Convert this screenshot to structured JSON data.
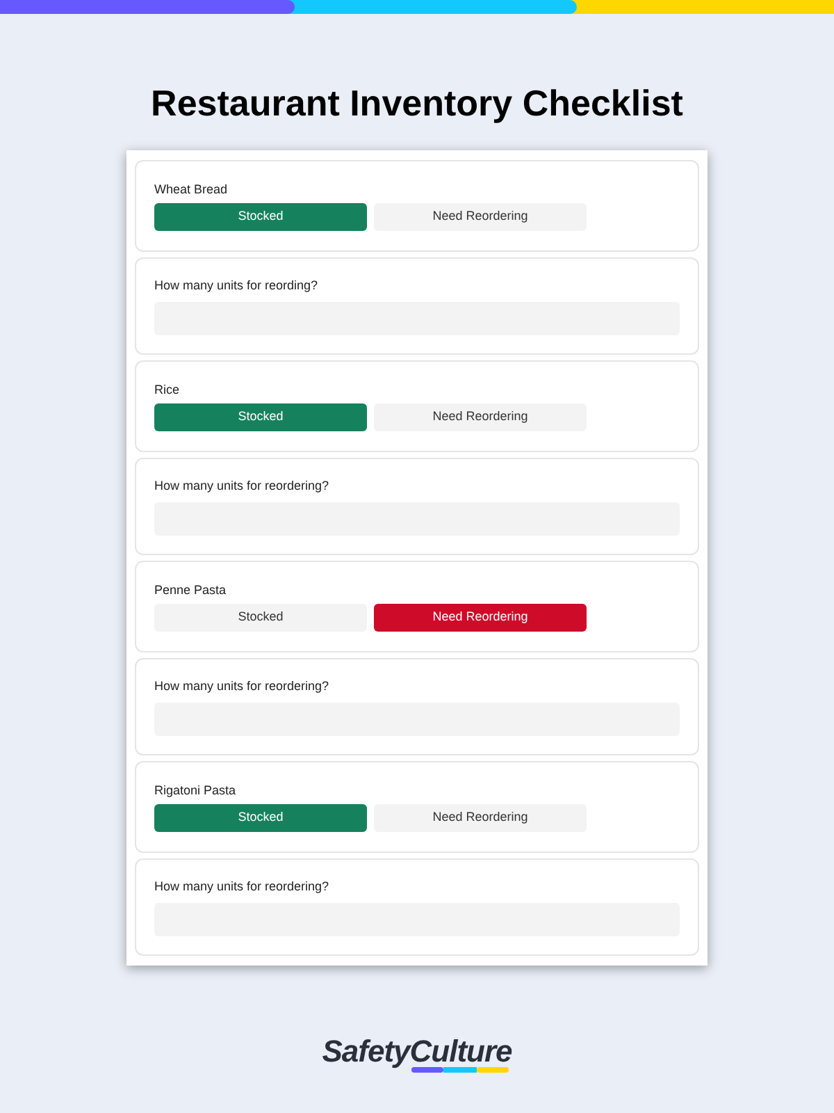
{
  "title": "Restaurant Inventory Checklist",
  "items": [
    {
      "name": "Wheat Bread",
      "options": [
        {
          "label": "Stocked",
          "kind": "positive",
          "selected": true
        },
        {
          "label": "Need Reordering",
          "kind": "negative",
          "selected": false
        }
      ],
      "question": {
        "label": "How many units for reording?"
      }
    },
    {
      "name": "Rice",
      "options": [
        {
          "label": "Stocked",
          "kind": "positive",
          "selected": true
        },
        {
          "label": "Need Reordering",
          "kind": "negative",
          "selected": false
        }
      ],
      "question": {
        "label": "How many units for reordering?"
      }
    },
    {
      "name": "Penne Pasta",
      "options": [
        {
          "label": "Stocked",
          "kind": "positive",
          "selected": false
        },
        {
          "label": "Need Reordering",
          "kind": "negative",
          "selected": true
        }
      ],
      "question": {
        "label": "How many units for reordering?"
      }
    },
    {
      "name": "Rigatoni Pasta",
      "options": [
        {
          "label": "Stocked",
          "kind": "positive",
          "selected": true
        },
        {
          "label": "Need Reordering",
          "kind": "negative",
          "selected": false
        }
      ],
      "question": {
        "label": "How many units for reordering?"
      }
    }
  ],
  "brand": {
    "logo": "SafetyCulture"
  }
}
